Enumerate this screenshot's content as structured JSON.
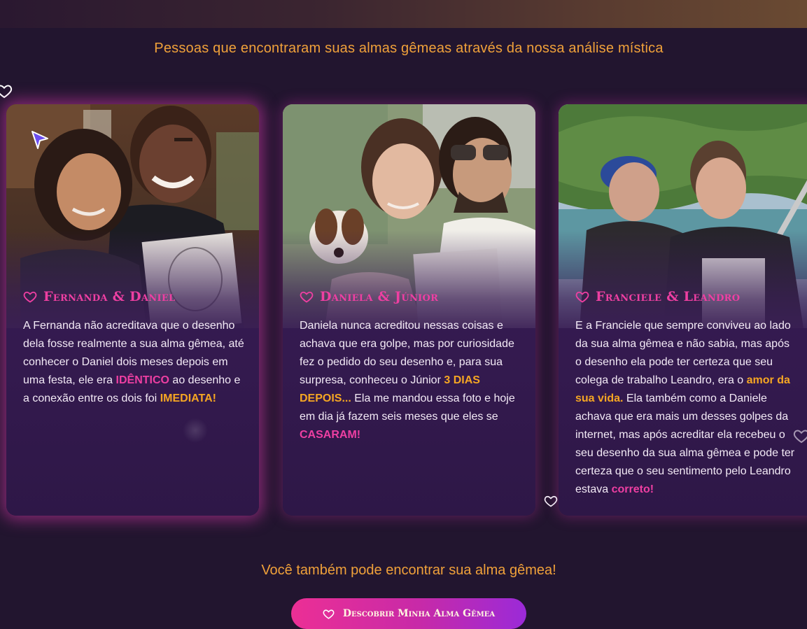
{
  "header": {
    "subtitle": "Pessoas que encontraram suas almas gêmeas através da nossa análise mística"
  },
  "testimonials": [
    {
      "title": "Fernanda & Daniel",
      "photo_alt": "Foto de Fernanda e Daniel segurando o desenho",
      "text_1": "A Fernanda não acreditava que o desenho dela fosse realmente a sua alma gêmea, até conhecer o Daniel dois meses depois em uma festa, ele era",
      "highlight_1": "IDÊNTICO",
      "text_2": " ao desenho e a conexão entre os dois foi ",
      "highlight_2": "IMEDIATA!"
    },
    {
      "title": "Daniela & Júnior",
      "photo_alt": "Foto de Daniela e Júnior com um cachorro e o desenho",
      "text_1": "Daniela nunca acreditou nessas coisas e achava que era golpe, mas por curiosidade fez o pedido do seu desenho e, para sua surpresa, conheceu o Júnior ",
      "highlight_1": "3 DIAS DEPOIS...",
      "text_2": " Ela me mandou essa foto e hoje em dia já fazem seis meses que eles se ",
      "highlight_2": "CASARAM!"
    },
    {
      "title": "Franciele & Leandro",
      "photo_alt": "Foto de Franciele e Leandro em um barco com o desenho",
      "text_1": "E a Franciele que sempre conviveu ao lado da sua alma gêmea e não sabia, mas após o desenho ela pode ter certeza que seu colega de trabalho Leandro, era o ",
      "highlight_1": "amor da sua vida.",
      "text_2": " Ela também como a Daniele achava que era mais um desses golpes da internet, mas após acreditar ela recebeu o seu desenho da sua alma gêmea e pode ter certeza que o seu sentimento pelo Leandro estava ",
      "highlight_2": "correto!"
    }
  ],
  "cta": {
    "text": "Você também pode encontrar sua alma gêmea!",
    "button_label": "Descobrir Minha Alma Gêmea"
  },
  "colors": {
    "accent_pink": "#ee3fa2",
    "accent_orange": "#f0a13a",
    "background": "#22152f",
    "card": "#3a1f55"
  },
  "icons": [
    "heart-icon",
    "cursor-arrow-icon"
  ]
}
